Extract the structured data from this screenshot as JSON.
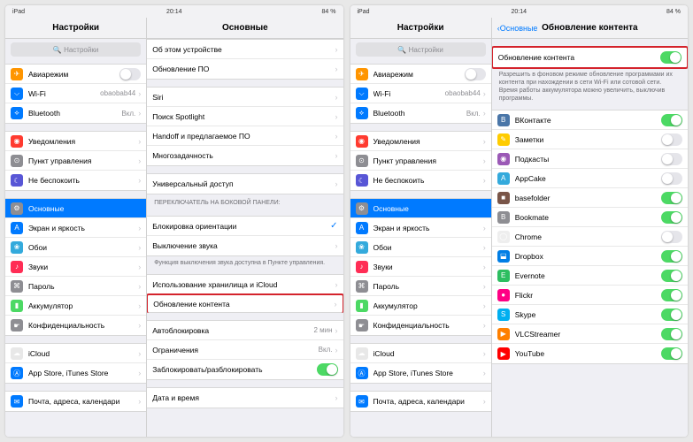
{
  "status": {
    "device": "iPad",
    "wifi": "⋮",
    "time": "20:14",
    "battery": "84 %"
  },
  "left": {
    "sidebarTitle": "Настройки",
    "mainTitle": "Основные",
    "search": "Настройки",
    "sidebar": [
      [
        {
          "ic": "#ff9500",
          "g": "✈",
          "t": "Авиарежим",
          "tog": "off"
        },
        {
          "ic": "#007aff",
          "g": "⌵",
          "t": "Wi-Fi",
          "v": "obaobab44"
        },
        {
          "ic": "#007aff",
          "g": "⟡",
          "t": "Bluetooth",
          "v": "Вкл."
        }
      ],
      [
        {
          "ic": "#ff3b30",
          "g": "◉",
          "t": "Уведомления"
        },
        {
          "ic": "#8e8e93",
          "g": "⊙",
          "t": "Пункт управления"
        },
        {
          "ic": "#5856d6",
          "g": "☾",
          "t": "Не беспокоить"
        }
      ],
      [
        {
          "ic": "#8e8e93",
          "g": "⚙",
          "t": "Основные",
          "sel": true
        },
        {
          "ic": "#007aff",
          "g": "A",
          "t": "Экран и яркость"
        },
        {
          "ic": "#34aadc",
          "g": "❀",
          "t": "Обои"
        },
        {
          "ic": "#ff2d55",
          "g": "♪",
          "t": "Звуки"
        },
        {
          "ic": "#8e8e93",
          "g": "⌘",
          "t": "Пароль"
        },
        {
          "ic": "#4cd964",
          "g": "▮",
          "t": "Аккумулятор"
        },
        {
          "ic": "#8e8e93",
          "g": "☛",
          "t": "Конфиденциальность"
        }
      ],
      [
        {
          "ic": "#fff",
          "g": "☁",
          "t": "iCloud",
          "b": "#e8e8e8"
        },
        {
          "ic": "#007aff",
          "g": "Ⓐ",
          "t": "App Store, iTunes Store"
        }
      ],
      [
        {
          "ic": "#007aff",
          "g": "✉",
          "t": "Почта, адреса, календари"
        }
      ]
    ],
    "main": [
      {
        "rows": [
          {
            "t": "Об этом устройстве"
          },
          {
            "t": "Обновление ПО"
          }
        ]
      },
      {
        "rows": [
          {
            "t": "Siri"
          },
          {
            "t": "Поиск Spotlight"
          },
          {
            "t": "Handoff и предлагаемое ПО"
          },
          {
            "t": "Многозадачность"
          }
        ]
      },
      {
        "rows": [
          {
            "t": "Универсальный доступ"
          }
        ]
      },
      {
        "h": "Переключатель на боковой панели:",
        "rows": [
          {
            "t": "Блокировка ориентации",
            "chk": true
          },
          {
            "t": "Выключение звука"
          }
        ],
        "f": "Функция выключения звука доступна в Пункте управления."
      },
      {
        "rows": [
          {
            "t": "Использование хранилища и iCloud"
          },
          {
            "t": "Обновление контента",
            "hl": true
          }
        ]
      },
      {
        "rows": [
          {
            "t": "Автоблокировка",
            "v": "2 мин"
          },
          {
            "t": "Ограничения",
            "v": "Вкл."
          },
          {
            "t": "Заблокировать/разблокировать",
            "tog": "on"
          }
        ]
      },
      {
        "rows": [
          {
            "t": "Дата и время"
          }
        ]
      }
    ]
  },
  "right": {
    "sidebarTitle": "Настройки",
    "back": "Основные",
    "mainTitle": "Обновление контента",
    "search": "Настройки",
    "master": {
      "t": "Обновление контента",
      "tog": "on",
      "hl": true,
      "f": "Разрешить в фоновом режиме обновление программами их контента при нахождении в сети Wi-Fi или сотовой сети. Время работы аккумулятора можно увеличить, выключив программы."
    },
    "apps": [
      {
        "ic": "#4a76a8",
        "g": "B",
        "t": "ВКонтакте",
        "tog": "on"
      },
      {
        "ic": "#ffcc00",
        "g": "✎",
        "t": "Заметки",
        "tog": "off"
      },
      {
        "ic": "#9b59b6",
        "g": "◉",
        "t": "Подкасты",
        "tog": "off"
      },
      {
        "ic": "#34aadc",
        "g": "A",
        "t": "AppCake",
        "tog": "off"
      },
      {
        "ic": "#795548",
        "g": "■",
        "t": "basefolder",
        "tog": "on"
      },
      {
        "ic": "#8e8e93",
        "g": "B",
        "t": "Bookmate",
        "tog": "on"
      },
      {
        "ic": "#fff",
        "g": "◯",
        "t": "Chrome",
        "tog": "off",
        "b": "#eee"
      },
      {
        "ic": "#007ee5",
        "g": "⬓",
        "t": "Dropbox",
        "tog": "on"
      },
      {
        "ic": "#2dbe60",
        "g": "E",
        "t": "Evernote",
        "tog": "on"
      },
      {
        "ic": "#ff0084",
        "g": "●",
        "t": "Flickr",
        "tog": "on"
      },
      {
        "ic": "#00aff0",
        "g": "S",
        "t": "Skype",
        "tog": "on"
      },
      {
        "ic": "#ff8000",
        "g": "▶",
        "t": "VLCStreamer",
        "tog": "on"
      },
      {
        "ic": "#ff0000",
        "g": "▶",
        "t": "YouTube",
        "tog": "on"
      }
    ]
  }
}
